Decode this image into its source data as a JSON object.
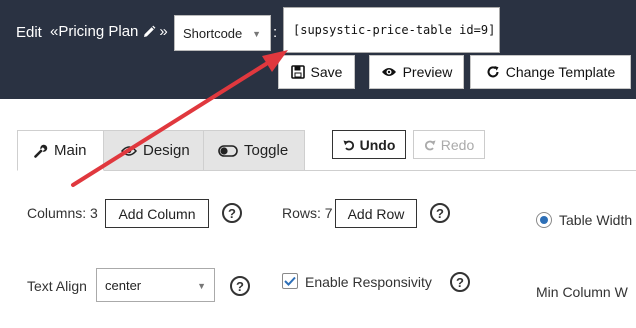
{
  "header": {
    "edit_label": "Edit",
    "title": "«Pricing Plan",
    "title_suffix": "»",
    "shortcode_select": "Shortcode",
    "colon": ":",
    "shortcode_value": "[supsystic-price-table id=9]",
    "save_label": "Save",
    "preview_label": "Preview",
    "change_template_label": "Change Template"
  },
  "tabs": [
    {
      "label": "Main",
      "icon": "wrench-icon",
      "active": true
    },
    {
      "label": "Design",
      "icon": "eye-icon",
      "active": false
    },
    {
      "label": "Toggle",
      "icon": "toggle-icon",
      "active": false
    }
  ],
  "history": {
    "undo_label": "Undo",
    "redo_label": "Redo"
  },
  "main": {
    "columns_label": "Columns: 3",
    "add_column_label": "Add Column",
    "rows_label": "Rows: 7",
    "add_row_label": "Add Row",
    "table_width_label": "Table Width",
    "text_align_label": "Text Align",
    "text_align_value": "center",
    "enable_responsivity_label": "Enable Responsivity",
    "enable_responsivity_checked": true,
    "min_column_label": "Min Column W",
    "help_glyph": "?"
  },
  "colors": {
    "header_bg": "#2a3242",
    "annotation_arrow": "#e0383e",
    "accent": "#2d6fb7"
  }
}
